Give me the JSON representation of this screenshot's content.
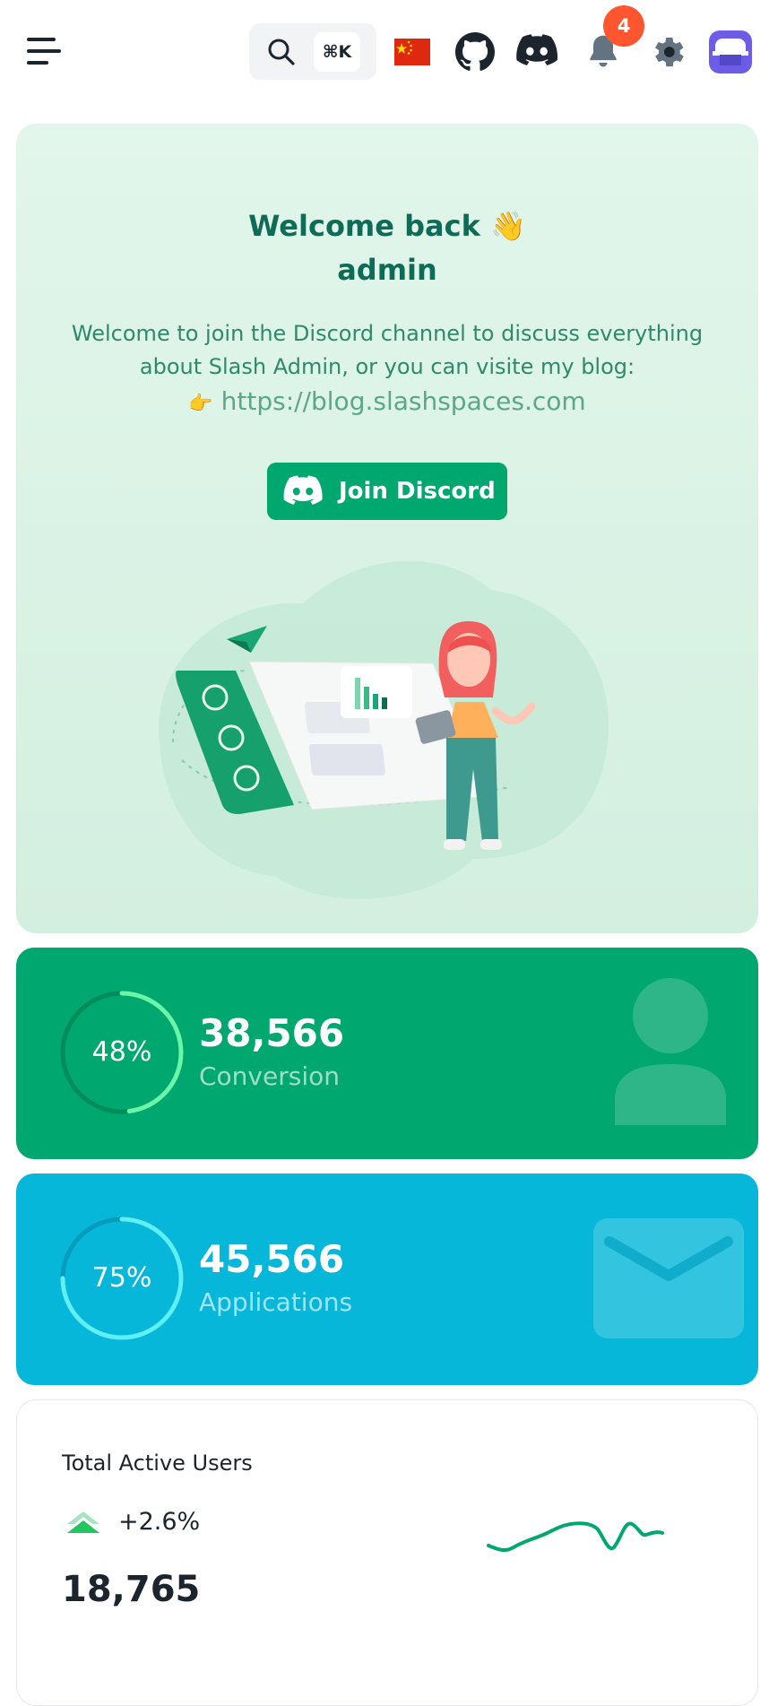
{
  "header": {
    "search_shortcut": "⌘K",
    "notification_count": "4",
    "icons": [
      "menu-icon",
      "search-icon",
      "cn-flag-icon",
      "github-icon",
      "discord-icon",
      "bell-icon",
      "gear-icon",
      "avatar"
    ]
  },
  "welcome": {
    "title_line1": "Welcome back 👋",
    "title_line2": "admin",
    "description": "Welcome to join the Discord channel to discuss everything about Slash Admin, or you can visite my blog:",
    "link_pointer": "👉",
    "link_text": "https://blog.slashspaces.com",
    "button_label": "Join Discord"
  },
  "stats": [
    {
      "percent": "48%",
      "percent_value": 48,
      "value": "38,566",
      "label": "Conversion",
      "color": "#00a76f",
      "bg_icon": "user-icon"
    },
    {
      "percent": "75%",
      "percent_value": 75,
      "value": "45,566",
      "label": "Applications",
      "color": "#07b7d9",
      "bg_icon": "mail-icon"
    }
  ],
  "active_users": {
    "title": "Total Active Users",
    "change": "+2.6%",
    "trend": "up",
    "value": "18,765",
    "sparkline_color": "#00a76f"
  },
  "colors": {
    "primary": "#00a76f",
    "info": "#07b7d9",
    "badge": "#ff5630",
    "welcome_text": "#0e6b56"
  }
}
